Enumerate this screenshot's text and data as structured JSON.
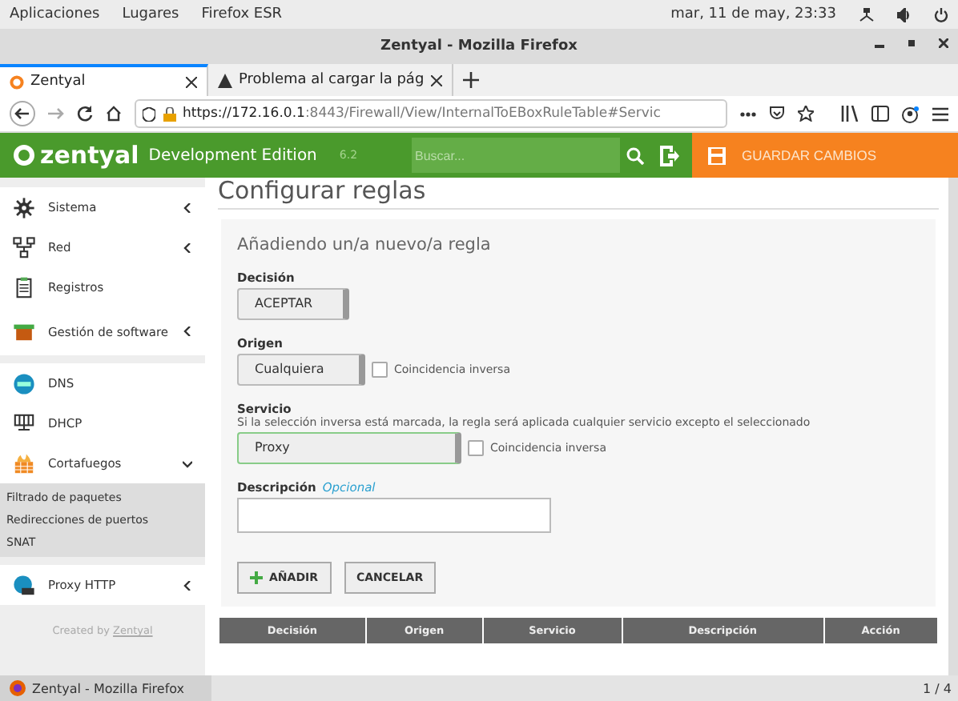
{
  "top_bar": {
    "menus": [
      "Aplicaciones",
      "Lugares",
      "Firefox ESR"
    ],
    "clock": "mar, 11 de may, 23:33"
  },
  "window": {
    "title": "Zentyal - Mozilla Firefox"
  },
  "tabs": [
    {
      "label": "Zentyal",
      "selected": true
    },
    {
      "label": "Problema al cargar la pág",
      "selected": false
    }
  ],
  "address_bar": {
    "host": "https://172.16.0.1",
    "rest": ":8443/Firewall/View/InternalToEBoxRuleTable#Servic"
  },
  "header": {
    "brand": "zentyal",
    "edition": "Development Edition",
    "version": "6.2",
    "search": {
      "placeholder": "Buscar..."
    },
    "save_button": "GUARDAR CAMBIOS"
  },
  "sidebar": {
    "items": [
      {
        "label": "Sistema",
        "kind": "group",
        "expanded": false
      },
      {
        "label": "Red",
        "kind": "group",
        "expanded": false
      },
      {
        "label": "Registros",
        "kind": "link"
      },
      {
        "label": "Gestión de software",
        "kind": "group",
        "expanded": false
      },
      {
        "label": "DNS",
        "kind": "link"
      },
      {
        "label": "DHCP",
        "kind": "link"
      },
      {
        "label": "Cortafuegos",
        "kind": "group",
        "expanded": true,
        "children": [
          {
            "label": "Filtrado de paquetes"
          },
          {
            "label": "Redirecciones de puertos"
          },
          {
            "label": "SNAT"
          }
        ]
      },
      {
        "label": "Proxy HTTP",
        "kind": "group",
        "expanded": false
      }
    ],
    "footer": "Created by",
    "footer_link": "Zentyal"
  },
  "page_title": "Configurar reglas",
  "form": {
    "title": "Añadiendo un/a nuevo/a regla",
    "decision": {
      "label": "Decisión",
      "value": "ACEPTAR"
    },
    "origin": {
      "label": "Origen",
      "value": "Cualquiera",
      "inverse_label": "Coincidencia inversa",
      "inverse_checked": false
    },
    "service": {
      "label": "Servicio",
      "help": "Si la selección inversa está marcada, la regla será aplicada cualquier servicio excepto el seleccionado",
      "value": "Proxy",
      "inverse_label": "Coincidencia inversa",
      "inverse_checked": false
    },
    "description": {
      "label": "Descripción",
      "optional": "Opcional"
    },
    "buttons": [
      "AÑADIR",
      "CANCELAR"
    ]
  },
  "table": {
    "columns": [
      "Decisión",
      "Origen",
      "Servicio",
      "Descripción",
      "Acción"
    ]
  },
  "taskbar": {
    "window": "Zentyal - Mozilla Firefox",
    "workspace": "1 / 4"
  }
}
